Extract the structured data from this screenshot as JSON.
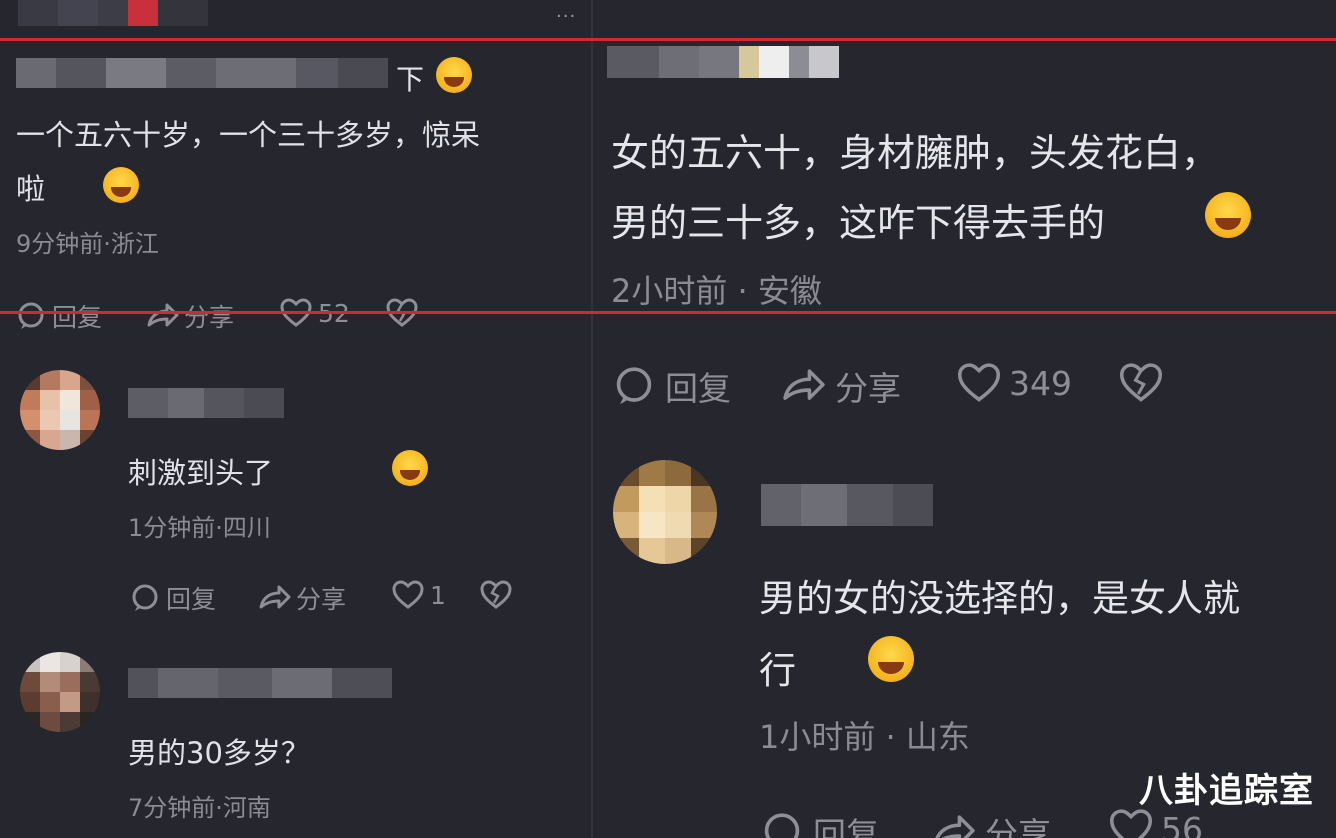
{
  "top_comment_left": {
    "username_suffix": "下",
    "text_line1": "一个五六十岁，一个三十多岁，惊呆",
    "text_line2": "啦",
    "meta": "9分钟前·浙江",
    "reply_label": "回复",
    "share_label": "分享",
    "like_count": "52"
  },
  "top_comment_right": {
    "text_line1": "女的五六十，身材臃肿，头发花白，",
    "text_line2": "男的三十多，这咋下得去手的",
    "meta": "2小时前 · 安徽",
    "reply_label": "回复",
    "share_label": "分享",
    "like_count": "349"
  },
  "left_replies": [
    {
      "text": "刺激到头了",
      "meta": "1分钟前·四川",
      "reply_label": "回复",
      "share_label": "分享",
      "like_count": "1"
    },
    {
      "text": "男的30多岁？",
      "meta": "7分钟前·河南"
    }
  ],
  "right_reply": {
    "text_line1": "男的女的没选择的，是女人就",
    "text_line2": "行",
    "meta": "1小时前 · 山东",
    "reply_label": "回复",
    "share_label": "分享",
    "like_count": "56"
  },
  "watermark": "八卦追踪室",
  "colors": {
    "background": "#26262f",
    "highlight_line": "#d4282c",
    "text": "#d6d6da",
    "meta": "#8b8b93"
  }
}
